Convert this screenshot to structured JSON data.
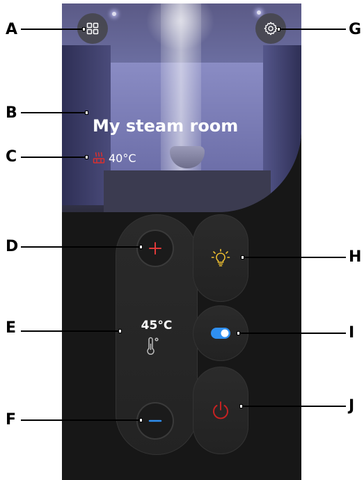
{
  "callouts": {
    "a": "A",
    "b": "B",
    "c": "C",
    "d": "D",
    "e": "E",
    "f": "F",
    "g": "G",
    "h": "H",
    "i": "I",
    "j": "J"
  },
  "room": {
    "name": "My steam room",
    "current_temperature": "40°C"
  },
  "temperature_control": {
    "setpoint": "45°C"
  },
  "icons": {
    "menu": "grid-icon",
    "settings": "gear-icon",
    "heater": "steam-heater-icon",
    "increase": "plus-icon",
    "decrease": "minus-icon",
    "thermometer": "thermometer-icon",
    "light": "light-bulb-icon",
    "toggle": "toggle-icon",
    "power": "power-icon"
  },
  "colors": {
    "background": "#171717",
    "increase": "#e03a3a",
    "decrease": "#2f8ff0",
    "light": "#f2c230",
    "toggle": "#2f8ff0",
    "power": "#c52222",
    "heater": "#d83030"
  },
  "toggle": {
    "state": "on"
  }
}
